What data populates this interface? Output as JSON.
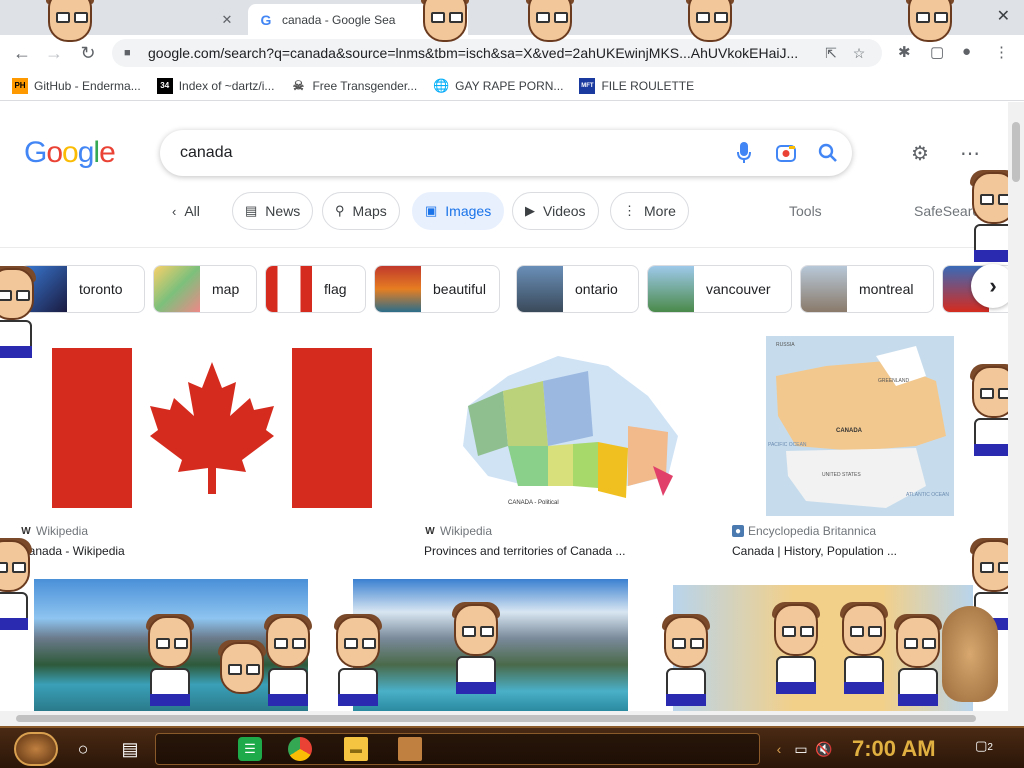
{
  "tabs": [
    {
      "title": "",
      "close": "✕"
    },
    {
      "title": "canada - Google Sea",
      "close": "✕"
    }
  ],
  "window_close": "✕",
  "address": {
    "url": "google.com/search?q=canada&source=lnms&tbm=isch&sa=X&ved=2ahUKEwinjMKS...AhUVkokEHaiJ..."
  },
  "bookmarks": [
    {
      "icon": "PH",
      "label": "GitHub - Enderma..."
    },
    {
      "icon": "34",
      "label": "Index of ~dartz/i..."
    },
    {
      "icon": "",
      "label": "Free Transgender..."
    },
    {
      "icon": "",
      "label": "GAY RAPE PORN..."
    },
    {
      "icon": "MFT",
      "label": "FILE ROULETTE"
    }
  ],
  "search": {
    "query": "canada"
  },
  "filters": {
    "all": "All",
    "news": "News",
    "maps": "Maps",
    "images": "Images",
    "videos": "Videos",
    "more": "More",
    "tools": "Tools",
    "safesearch": "SafeSearch"
  },
  "related": [
    {
      "label": "toronto"
    },
    {
      "label": "map"
    },
    {
      "label": "flag"
    },
    {
      "label": "beautiful"
    },
    {
      "label": "ontario"
    },
    {
      "label": "vancouver"
    },
    {
      "label": "montreal"
    }
  ],
  "results": [
    {
      "source": "Wikipedia",
      "title": "Canada - Wikipedia"
    },
    {
      "source": "Wikipedia",
      "title": "Provinces and territories of Canada ..."
    },
    {
      "source": "Encyclopedia Britannica",
      "title": "Canada | History, Population ..."
    }
  ],
  "map_labels": {
    "canada": "CANADA",
    "us": "UNITED STATES",
    "greenland": "GREENLAND",
    "russia": "RUSSIA",
    "pacific": "PACIFIC OCEAN",
    "atlantic": "ATLANTIC OCEAN",
    "political": "CANADA - Political"
  },
  "taskbar": {
    "clock": "7:00 AM",
    "notifications": "2"
  },
  "colors": {
    "accent": "#1a73e8",
    "flag_red": "#d52b1e",
    "taskbar": "#3a1f0c",
    "clock": "#e0b040"
  }
}
